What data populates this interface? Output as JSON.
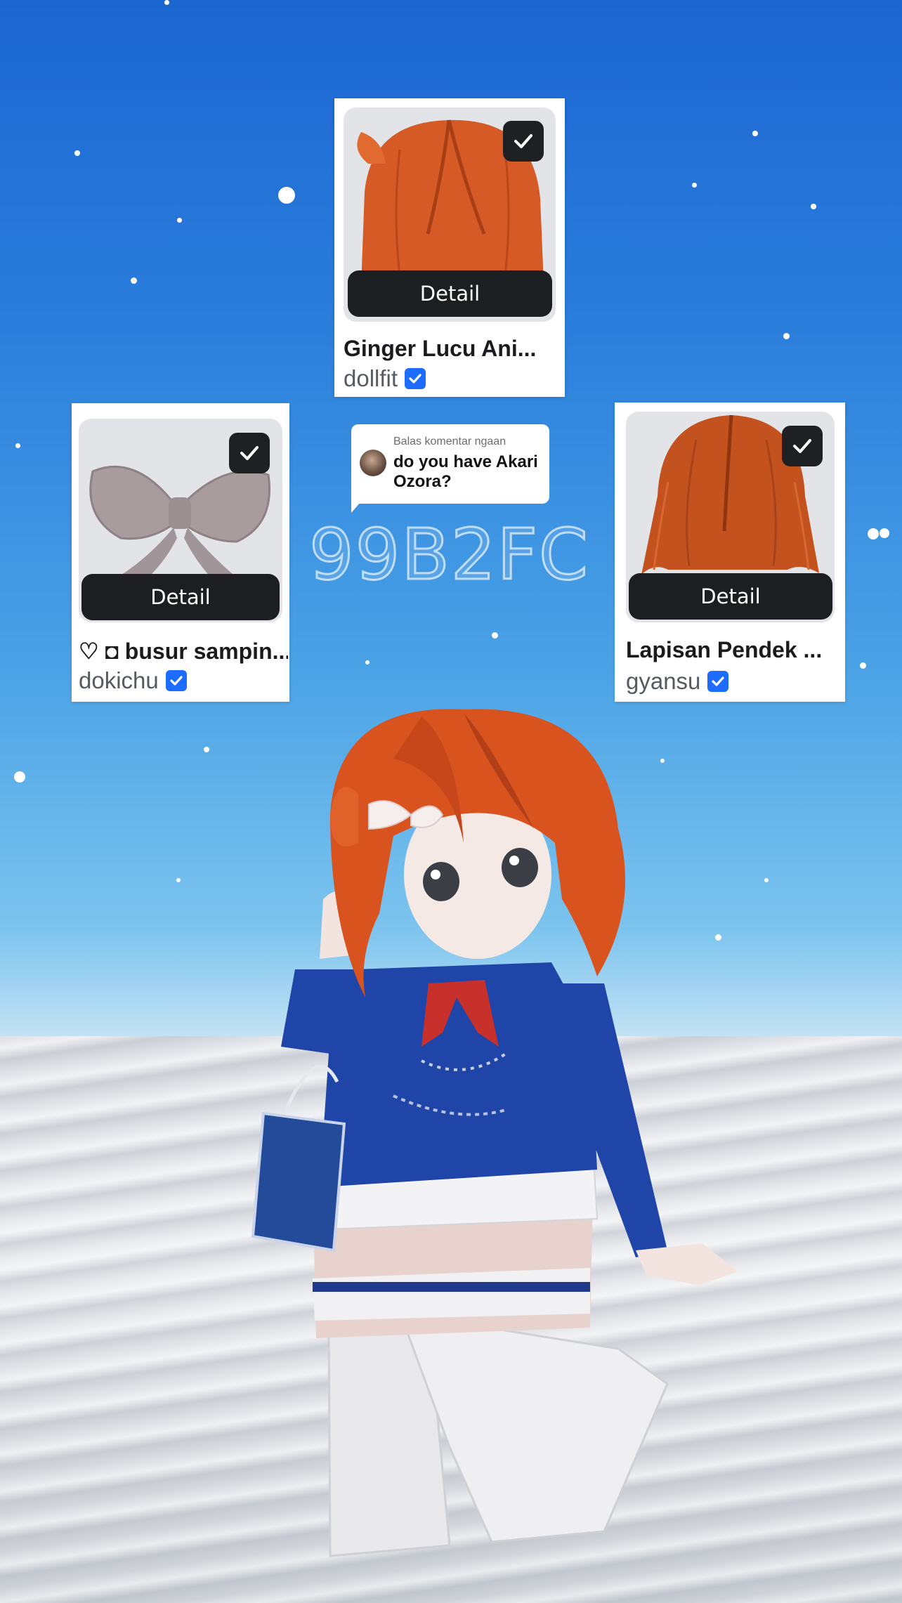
{
  "cards": [
    {
      "title": "Ginger Lucu Ani...",
      "creator": "dollfit",
      "detail_label": "Detail",
      "checked": true,
      "thumb_icon": "ginger-hair-icon"
    },
    {
      "title": "♡ ◘ busur sampin...",
      "creator": "dokichu",
      "detail_label": "Detail",
      "checked": true,
      "thumb_icon": "bow-icon"
    },
    {
      "title": "Lapisan Pendek ...",
      "creator": "gyansu",
      "detail_label": "Detail",
      "checked": true,
      "thumb_icon": "layered-hair-icon"
    }
  ],
  "reply_bubble": {
    "label": "Balas komentar ngaan",
    "text": "do you have Akari Ozora?"
  },
  "watermark_code": "99B2FC",
  "colors": {
    "sky_top": "#1c66d2",
    "sky_bottom": "#c2e2f4",
    "hair": "#d9531e",
    "outfit_blue": "#1f45a8",
    "verified_badge": "#1e6bff",
    "detail_button": "#1d1e22"
  }
}
